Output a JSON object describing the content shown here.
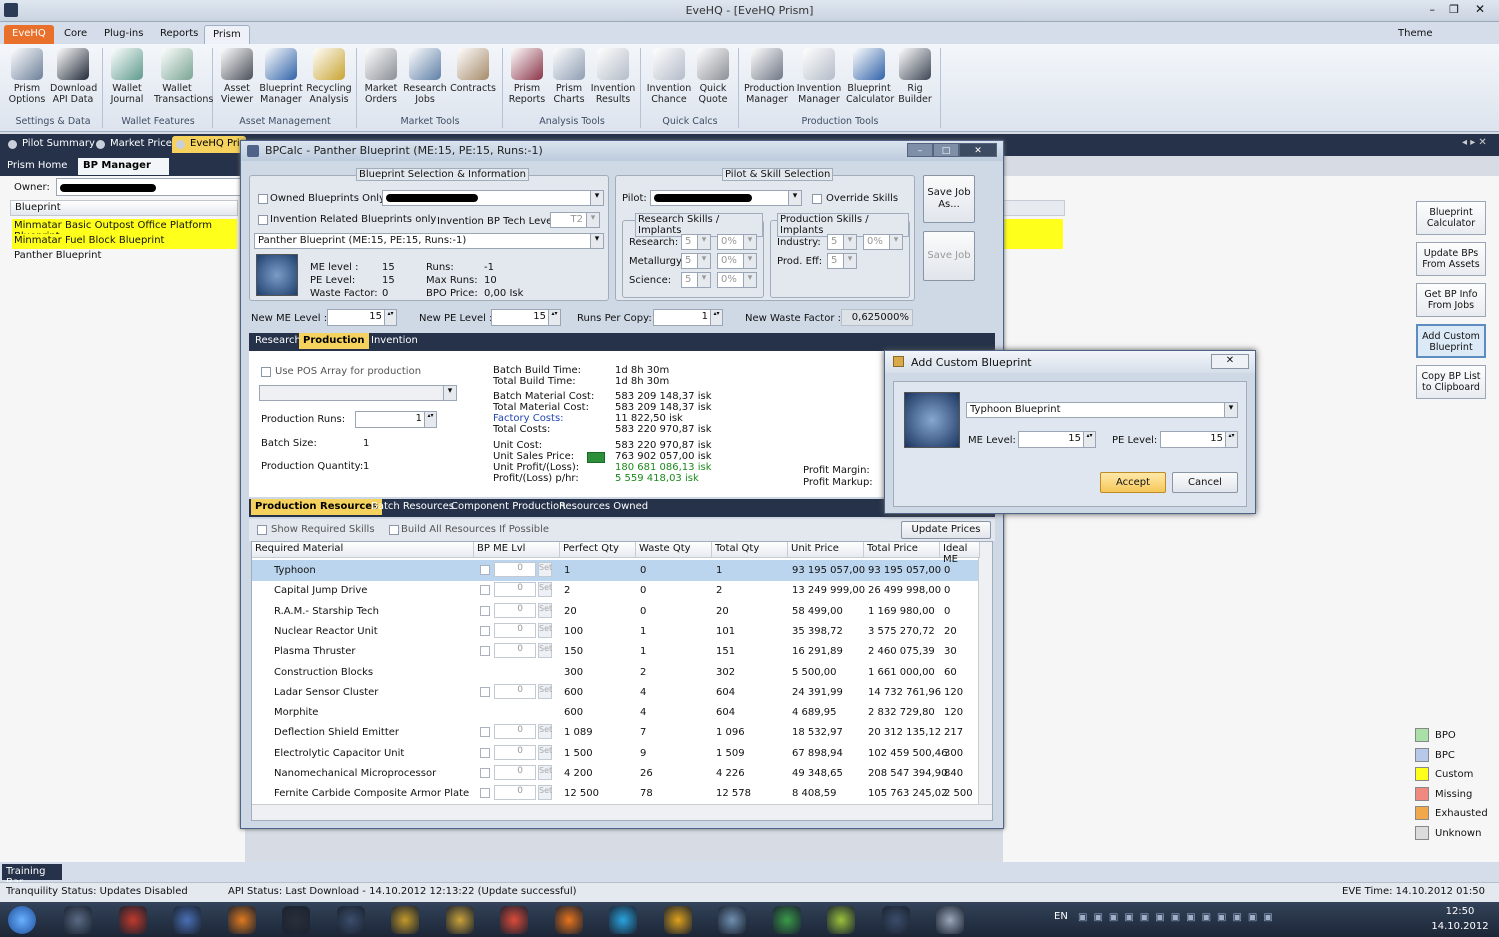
{
  "window": {
    "title": "EveHQ - [EveHQ Prism]",
    "theme_label": "Theme"
  },
  "ribbon_tabs": [
    "EveHQ",
    "Core",
    "Plug-ins",
    "Reports",
    "Prism"
  ],
  "ribbon_buttons": [
    {
      "label": "Prism Options",
      "icon": "gear-icon",
      "color": "#6c7f99"
    },
    {
      "label": "Download API Data",
      "icon": "server-icon",
      "color": "#222a38"
    },
    {
      "label": "Wallet Journal",
      "icon": "wallet-icon",
      "color": "#5e9a8c"
    },
    {
      "label": "Wallet Transactions",
      "icon": "transactions-icon",
      "color": "#7aa493"
    },
    {
      "label": "Asset Viewer",
      "icon": "cube-icon",
      "color": "#4a4f58"
    },
    {
      "label": "Blueprint Manager",
      "icon": "blueprint-icon",
      "color": "#2f62a8"
    },
    {
      "label": "Recycling Analysis",
      "icon": "recycle-icon",
      "color": "#c9a430"
    },
    {
      "label": "Market Orders",
      "icon": "orders-icon",
      "color": "#8a8f96"
    },
    {
      "label": "Research Jobs",
      "icon": "research-icon",
      "color": "#5e7fa6"
    },
    {
      "label": "Contracts",
      "icon": "contract-icon",
      "color": "#a68a6a"
    },
    {
      "label": "Prism Reports",
      "icon": "book-icon",
      "color": "#8a3448"
    },
    {
      "label": "Prism Charts",
      "icon": "chart-icon",
      "color": "#8e9db2"
    },
    {
      "label": "Invention Results",
      "icon": "flask-icon",
      "color": "#b4bcc8"
    },
    {
      "label": "Invention Chance",
      "icon": "flask-icon",
      "color": "#b4bcc8"
    },
    {
      "label": "Quick Quote",
      "icon": "quote-icon",
      "color": "#8b8f96"
    },
    {
      "label": "Production Manager",
      "icon": "factory-icon",
      "color": "#707785"
    },
    {
      "label": "Invention Manager",
      "icon": "flask-icon",
      "color": "#b4bcc8"
    },
    {
      "label": "Blueprint Calculator",
      "icon": "calculator-icon",
      "color": "#2f62a8"
    },
    {
      "label": "Rig Builder",
      "icon": "rig-icon",
      "color": "#3d4654"
    }
  ],
  "ribbon_groups": [
    "Settings & Data",
    "Wallet Features",
    "Asset Management",
    "Market Tools",
    "Analysis Tools",
    "Quick Calcs",
    "Production Tools"
  ],
  "doc_tabs": [
    "Pilot Summary",
    "Market Prices",
    "EveHQ Pri"
  ],
  "sub_tabs": [
    "Prism Home",
    "BP Manager"
  ],
  "left_panel": {
    "owner_label": "Owner:",
    "column_header": "Blueprint",
    "rows": [
      {
        "name": "Minmatar Basic Outpost Office Platform Blueprint",
        "highlight": true
      },
      {
        "name": "Minmatar Fuel Block Blueprint",
        "highlight": true
      },
      {
        "name": "Panther Blueprint",
        "highlight": false
      }
    ]
  },
  "side_buttons": [
    "Blueprint Calculator",
    "Update BPs From Assets",
    "Get BP Info From Jobs",
    "Add Custom Blueprint",
    "Copy BP List to Clipboard"
  ],
  "legend": [
    {
      "label": "BPO",
      "color": "#a8e0a8"
    },
    {
      "label": "BPC",
      "color": "#b7c9ea"
    },
    {
      "label": "Custom",
      "color": "#ffff1c"
    },
    {
      "label": "Missing",
      "color": "#f08a80"
    },
    {
      "label": "Exhausted",
      "color": "#f0a84a"
    },
    {
      "label": "Unknown",
      "color": "#dcdcdc"
    }
  ],
  "bpcalc": {
    "title": "BPCalc - Panther Blueprint (ME:15, PE:15, Runs:-1)",
    "bp_section": "Blueprint Selection & Information",
    "owned_only": "Owned Blueprints Only",
    "invention_related": "Invention Related Blueprints only",
    "inv_tech_label": "Invention BP Tech Level:",
    "inv_tech_value": "T2",
    "bp_select": "Panther Blueprint (ME:15, PE:15, Runs:-1)",
    "me_label": "ME level :",
    "me_value": "15",
    "pe_label": "PE Level:",
    "pe_value": "15",
    "waste_label": "Waste Factor:",
    "waste_value": "0",
    "runs_label": "Runs:",
    "runs_value": "-1",
    "maxruns_label": "Max Runs:",
    "maxruns_value": "10",
    "bpoprice_label": "BPO Price:",
    "bpoprice_value": "0,00 Isk",
    "pilot_section": "Pilot & Skill Selection",
    "pilot_label": "Pilot:",
    "override": "Override Skills",
    "research_skills": "Research Skills / Implants",
    "production_skills": "Production Skills / Implants",
    "research": "Research:",
    "metallurgy": "Metallurgy:",
    "science": "Science:",
    "industry": "Industry:",
    "prod_eff": "Prod. Eff:",
    "skill_level": "5",
    "implant": "0%",
    "save_job": "Save Job As...",
    "save_job2": "Save Job",
    "new_me_label": "New ME Level :",
    "new_me": "15",
    "new_pe_label": "New PE Level :",
    "new_pe": "15",
    "runs_copy_label": "Runs Per Copy:",
    "runs_copy": "1",
    "new_waste_label": "New Waste Factor :",
    "new_waste": "0,625000%",
    "tabs": [
      "Research",
      "Production",
      "Invention"
    ],
    "use_pos": "Use POS Array for production",
    "prod_runs_label": "Production Runs:",
    "prod_runs": "1",
    "batch_size_label": "Batch Size:",
    "batch_size": "1",
    "prod_qty_label": "Production Quantity:",
    "prod_qty": "1",
    "stats": [
      {
        "label": "Batch Build Time:",
        "value": "1d 8h 30m",
        "color": "#111"
      },
      {
        "label": "Total Build Time:",
        "value": "1d 8h 30m",
        "color": "#111"
      },
      {
        "label": "Batch Material Cost:",
        "value": "583 209 148,37 isk",
        "color": "#111"
      },
      {
        "label": "Total Material Cost:",
        "value": "583 209 148,37 isk",
        "color": "#111"
      },
      {
        "label": "Factory Costs:",
        "value": "11 822,50 isk",
        "color": "#111"
      },
      {
        "label": "Total Costs:",
        "value": "583 220 970,87 isk",
        "color": "#111"
      },
      {
        "label": "Unit Cost:",
        "value": "583 220 970,87 isk",
        "color": "#111"
      },
      {
        "label": "Unit Sales Price:",
        "value": "763 902 057,00 isk",
        "color": "#111"
      },
      {
        "label": "Unit Profit/(Loss):",
        "value": "180 681 086,13 isk",
        "color": "#1b8a1b"
      },
      {
        "label": "Profit/(Loss) p/hr:",
        "value": "5 559 418,03 isk",
        "color": "#1b8a1b"
      }
    ],
    "profit_margin": "Profit Margin:",
    "profit_markup": "Profit Markup:",
    "res_tabs": [
      "Production Resources",
      "Batch Resources",
      "Component Production",
      "Resources Owned"
    ],
    "show_req": "Show Required Skills",
    "build_all": "Build All Resources If Possible",
    "update_prices": "Update Prices",
    "columns": [
      "Required Material",
      "BP ME Lvl",
      "Perfect Qty",
      "Waste Qty",
      "Total Qty",
      "Unit Price",
      "Total Price",
      "Ideal ME"
    ],
    "rows": [
      {
        "m": "Typhoon",
        "me": true,
        "p": "1",
        "w": "0",
        "t": "1",
        "u": "93 195 057,00",
        "tp": "93 195 057,00",
        "i": "0"
      },
      {
        "m": "Capital Jump Drive",
        "me": true,
        "p": "2",
        "w": "0",
        "t": "2",
        "u": "13 249 999,00",
        "tp": "26 499 998,00",
        "i": "0"
      },
      {
        "m": "R.A.M.- Starship Tech",
        "me": true,
        "p": "20",
        "w": "0",
        "t": "20",
        "u": "58 499,00",
        "tp": "1 169 980,00",
        "i": "0"
      },
      {
        "m": "Nuclear Reactor Unit",
        "me": true,
        "p": "100",
        "w": "1",
        "t": "101",
        "u": "35 398,72",
        "tp": "3 575 270,72",
        "i": "20"
      },
      {
        "m": "Plasma Thruster",
        "me": true,
        "p": "150",
        "w": "1",
        "t": "151",
        "u": "16 291,89",
        "tp": "2 460 075,39",
        "i": "30"
      },
      {
        "m": "Construction Blocks",
        "me": false,
        "p": "300",
        "w": "2",
        "t": "302",
        "u": "5 500,00",
        "tp": "1 661 000,00",
        "i": "60"
      },
      {
        "m": "Ladar Sensor Cluster",
        "me": true,
        "p": "600",
        "w": "4",
        "t": "604",
        "u": "24 391,99",
        "tp": "14 732 761,96",
        "i": "120"
      },
      {
        "m": "Morphite",
        "me": false,
        "p": "600",
        "w": "4",
        "t": "604",
        "u": "4 689,95",
        "tp": "2 832 729,80",
        "i": "120"
      },
      {
        "m": "Deflection Shield Emitter",
        "me": true,
        "p": "1 089",
        "w": "7",
        "t": "1 096",
        "u": "18 532,97",
        "tp": "20 312 135,12",
        "i": "217"
      },
      {
        "m": "Electrolytic Capacitor Unit",
        "me": true,
        "p": "1 500",
        "w": "9",
        "t": "1 509",
        "u": "67 898,94",
        "tp": "102 459 500,46",
        "i": "300"
      },
      {
        "m": "Nanomechanical Microprocessor",
        "me": true,
        "p": "4 200",
        "w": "26",
        "t": "4 226",
        "u": "49 348,65",
        "tp": "208 547 394,90",
        "i": "840"
      },
      {
        "m": "Fernite Carbide Composite Armor Plate",
        "me": true,
        "p": "12 500",
        "w": "78",
        "t": "12 578",
        "u": "8 408,59",
        "tp": "105 763 245,02",
        "i": "2 500"
      }
    ],
    "me_cell_value": "0",
    "me_cell_btn": "Set"
  },
  "dialog": {
    "title": "Add Custom Blueprint",
    "blueprint": "Typhoon Blueprint",
    "me_label": "ME Level:",
    "me_value": "15",
    "pe_label": "PE Level:",
    "pe_value": "15",
    "accept": "Accept",
    "cancel": "Cancel"
  },
  "status": {
    "training_bar": "Training Bar",
    "tranquility": "Tranquility Status: Updates Disabled",
    "api": "API Status: Last Download - 14.10.2012 12:13:22 (Update successful)",
    "eve_time": "EVE Time: 14.10.2012 01:50"
  },
  "taskbar": {
    "lang": "EN",
    "time": "12:50",
    "date": "14.10.2012"
  }
}
